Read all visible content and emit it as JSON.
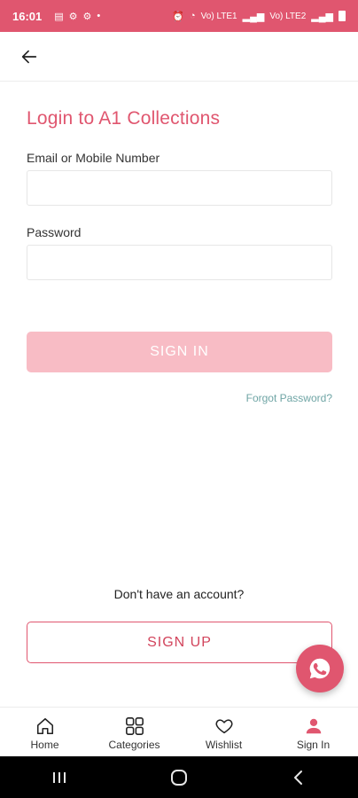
{
  "status_bar": {
    "time": "16:01",
    "dot": "•",
    "signal_label_1": "Vo) LTE1",
    "signal_label_2": "Vo) LTE2"
  },
  "header": {
    "back_icon": "arrow-left-icon"
  },
  "login": {
    "title": "Login to A1 Collections",
    "email_label": "Email or Mobile Number",
    "email_value": "",
    "email_placeholder": "",
    "password_label": "Password",
    "password_value": "",
    "password_placeholder": "",
    "signin_label": "SIGN IN",
    "forgot_label": "Forgot Password?",
    "no_account_text": "Don't have an account?",
    "signup_label": "SIGN UP"
  },
  "fab": {
    "icon": "whatsapp-icon"
  },
  "bottom_nav": {
    "items": [
      {
        "label": "Home",
        "icon": "home-icon"
      },
      {
        "label": "Categories",
        "icon": "categories-icon"
      },
      {
        "label": "Wishlist",
        "icon": "heart-icon"
      },
      {
        "label": "Sign In",
        "icon": "user-icon"
      }
    ]
  },
  "colors": {
    "brand": "#e0566f",
    "signin_disabled": "#f8bcc5",
    "forgot_link": "#6fa5a5"
  }
}
